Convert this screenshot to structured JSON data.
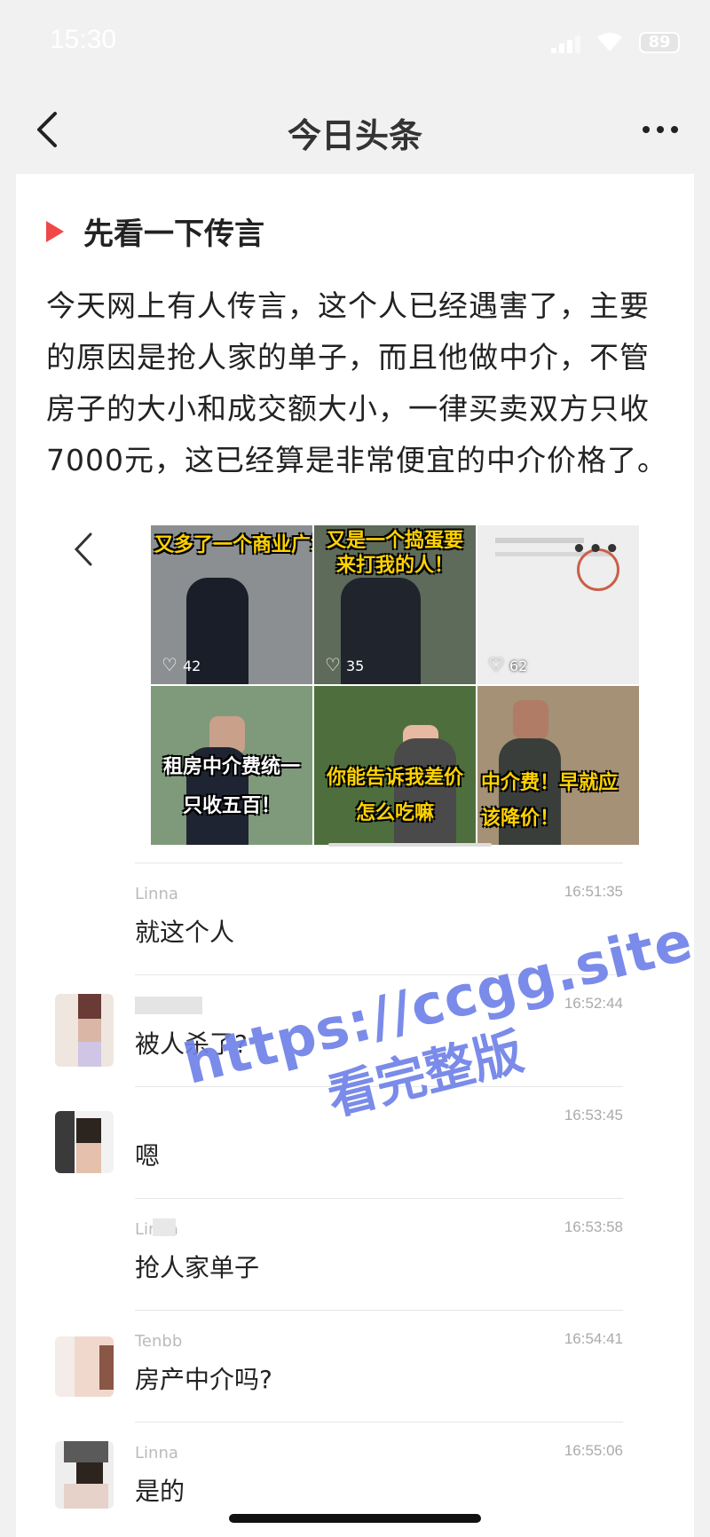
{
  "status_bar": {
    "time": "15:30",
    "battery": "89"
  },
  "nav": {
    "title": "今日头条"
  },
  "article": {
    "section_title": "先看一下传言",
    "paragraph": "今天网上有人传言，这个人已经遇害了，主要的原因是抢人家的单子，而且他做中介，不管房子的大小和成交额大小，一律买卖双方只收7000元，这已经算是非常便宜的中介价格了。"
  },
  "gallery": {
    "cells": [
      {
        "caption": "又多了一个商业广场哦",
        "likes": "42",
        "bg": "#8c8f92"
      },
      {
        "caption": "又是一个捣蛋要来打我的人！",
        "likes": "35",
        "bg": "#5e6a5a"
      },
      {
        "caption": "",
        "likes": "62",
        "bg": "#eeeeee"
      },
      {
        "caption": "租房中介费统一只收五百！",
        "likes": "",
        "bg": "#7f9a7a"
      },
      {
        "caption": "你能告诉我差价怎么吃嘛",
        "likes": "",
        "bg": "#4f6e3e"
      },
      {
        "caption": "中介费！早就应该降价！",
        "likes": "",
        "bg": "#a49176"
      }
    ]
  },
  "messages": [
    {
      "name": "Linna",
      "time": "16:51:35",
      "text": "就这个人",
      "avatar": false
    },
    {
      "name": "",
      "time": "16:52:44",
      "text": "被人杀了?",
      "avatar": true
    },
    {
      "name": "",
      "time": "16:53:45",
      "text": "嗯",
      "avatar": true
    },
    {
      "name": "Linna",
      "time": "16:53:58",
      "text": "抢人家单子",
      "avatar": false
    },
    {
      "name": "Tenbb",
      "time": "16:54:41",
      "text": "房产中介吗?",
      "avatar": true
    },
    {
      "name": "Linna",
      "time": "16:55:06",
      "text": "是的",
      "avatar": true
    }
  ],
  "watermark": {
    "line1": "https://ccgg.site",
    "line2": "看完整版"
  }
}
